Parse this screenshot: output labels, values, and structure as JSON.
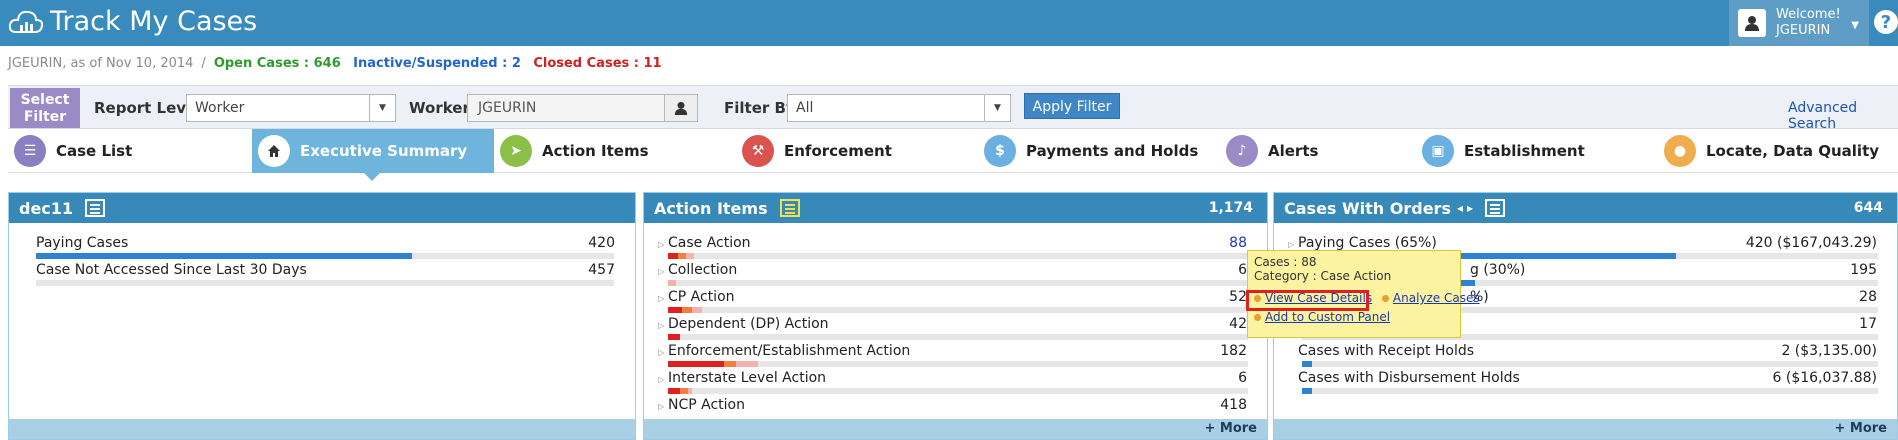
{
  "app": {
    "title": "Track My Cases"
  },
  "user": {
    "welcome": "Welcome!",
    "name": "JGEURIN",
    "help": "?"
  },
  "breadcrumb": {
    "user_date": "JGEURIN, as of Nov 10, 2014",
    "sep": "/",
    "open": "Open Cases : 646",
    "inactive": "Inactive/Suspended : 2",
    "closed": "Closed Cases : 11"
  },
  "filter": {
    "select_label": "Select Filter",
    "report_level_label": "Report Level",
    "report_level_value": "Worker",
    "worker_label": "Worker",
    "worker_value": "JGEURIN",
    "filter_by_label": "Filter By",
    "filter_by_value": "All",
    "apply_label": "Apply Filter",
    "advanced_search": "Advanced Search"
  },
  "tabs": [
    {
      "label": "Case List",
      "color": "#8a7fc0",
      "icon": "list-icon"
    },
    {
      "label": "Executive Summary",
      "active": true,
      "icon": "home-icon"
    },
    {
      "label": "Action Items",
      "color": "#8cbf4a",
      "icon": "send-icon"
    },
    {
      "label": "Enforcement",
      "color": "#d9534f",
      "icon": "gavel-icon"
    },
    {
      "label": "Payments and Holds",
      "color": "#6ab0e0",
      "icon": "money-icon"
    },
    {
      "label": "Alerts",
      "color": "#9a8bc7",
      "icon": "bell-icon"
    },
    {
      "label": "Establishment",
      "color": "#6ab0e0",
      "icon": "briefcase-icon"
    },
    {
      "label": "Locate, Data Quality",
      "color": "#f0ad4e",
      "icon": "map-pin-icon"
    }
  ],
  "panels": {
    "p1": {
      "title": "dec11",
      "footer": "",
      "rows": [
        {
          "label": "Paying Cases",
          "value": "420",
          "fill": 0.65
        },
        {
          "label": "Case Not Accessed Since Last 30 Days",
          "value": "457",
          "fill": 0
        }
      ]
    },
    "p2": {
      "title": "Action Items",
      "count": "1,174",
      "footer": "+ More",
      "rows": [
        {
          "label": "Case Action",
          "value": "88"
        },
        {
          "label": "Collection",
          "value": "6"
        },
        {
          "label": "CP Action",
          "value": "52"
        },
        {
          "label": "Dependent (DP) Action",
          "value": "42"
        },
        {
          "label": "Enforcement/Establishment Action",
          "value": "182"
        },
        {
          "label": "Interstate Level Action",
          "value": "6"
        },
        {
          "label": "NCP Action",
          "value": "418"
        }
      ]
    },
    "p3": {
      "title": "Cases With Orders",
      "nav": "◂ ▸",
      "count": "644",
      "footer": "+ More",
      "rows": [
        {
          "label": "Paying Cases (65%)",
          "value": "420 ($167,043.29)",
          "fill": 0.65
        },
        {
          "label": "g (30%)",
          "value": "195",
          "fill": 0.3
        },
        {
          "label": "%)",
          "value": "28",
          "fill": 0.0
        },
        {
          "label": "",
          "value": "17",
          "fill": 0.0
        },
        {
          "label": "Cases with Receipt Holds",
          "value": "2 ($3,135.00)",
          "fill": 0.02
        },
        {
          "label": "Cases with Disbursement Holds",
          "value": "6 ($16,037.88)",
          "fill": 0.03
        }
      ]
    }
  },
  "tooltip": {
    "cases": "Cases : 88",
    "category": "Category : Case Action",
    "view": "View Case Details",
    "analyze": "Analyze Cases",
    "add": "Add to Custom Panel"
  }
}
